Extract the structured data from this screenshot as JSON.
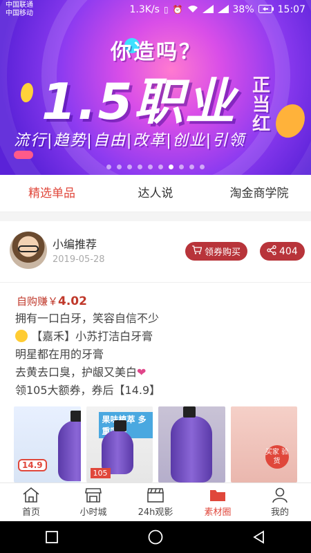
{
  "status": {
    "carrier1": "中国联通",
    "carrier2": "中国移动",
    "speed": "1.3K/s",
    "battery": "38%",
    "time": "15:07"
  },
  "banner": {
    "question": "你造吗？",
    "headline": "1.5职业",
    "side": "正当红",
    "tags": "流行|趋势|自由|改革|创业|引领",
    "dots": 10,
    "active_dot": 6
  },
  "tabs": [
    {
      "label": "精选单品",
      "active": true
    },
    {
      "label": "达人说",
      "active": false
    },
    {
      "label": "淘金商学院",
      "active": false
    }
  ],
  "post": {
    "author": "小编推荐",
    "date": "2019-05-28",
    "buy_label": "领券购买",
    "share_count": "404",
    "earn_label": "自购赚￥",
    "earn_amount": "4.02",
    "lines": [
      "拥有一口白牙，笑容自信不少",
      "【嘉禾】小苏打洁白牙膏",
      "明星都在用的牙膏",
      "去黄去口臭，护龈又美白",
      "领105大额券，券后【14.9】"
    ],
    "thumb1_badge": "14.9",
    "thumb2_title": "果味植萃 多重呵护",
    "thumb2_price": "105",
    "thumb4_badge": "买家 验货"
  },
  "bottom_nav": [
    {
      "label": "首页",
      "icon": "home-icon",
      "active": false
    },
    {
      "label": "小时城",
      "icon": "shop-icon",
      "active": false
    },
    {
      "label": "24h观影",
      "icon": "clapper-icon",
      "active": false
    },
    {
      "label": "素材圈",
      "icon": "folder-icon",
      "active": true
    },
    {
      "label": "我的",
      "icon": "user-icon",
      "active": false
    }
  ],
  "colors": {
    "accent": "#e0473b",
    "button": "#b8343a"
  }
}
